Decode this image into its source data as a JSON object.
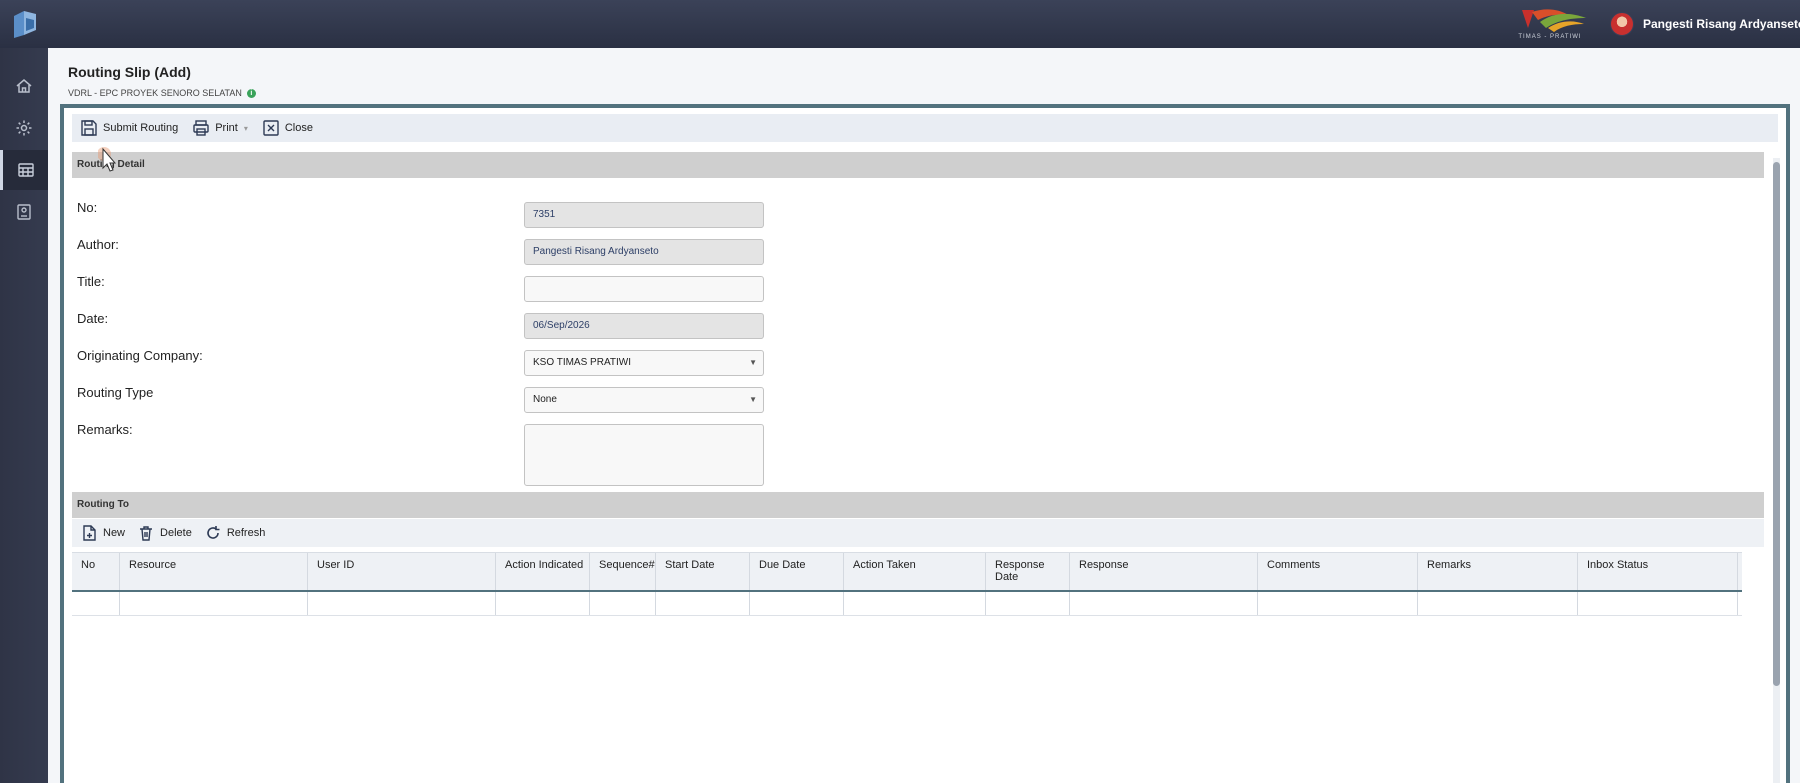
{
  "topbar": {
    "brand_logo_text": "TIMAS - PRATIWI",
    "user_name": "Pangesti Risang Ardyanseto"
  },
  "sidebar": {
    "items": [
      {
        "icon": "home-icon"
      },
      {
        "icon": "gear-icon"
      },
      {
        "icon": "dashboard-icon",
        "active": true
      },
      {
        "icon": "document-icon"
      }
    ]
  },
  "page": {
    "title": "Routing Slip (Add)",
    "subtitle": "VDRL - EPC PROYEK SENORO SELATAN"
  },
  "toolbar": {
    "submit_label": "Submit Routing",
    "print_label": "Print",
    "close_label": "Close"
  },
  "routing_detail": {
    "section_title": "Routing Detail",
    "fields": {
      "no_label": "No:",
      "no_value": "7351",
      "author_label": "Author:",
      "author_value": "Pangesti Risang Ardyanseto",
      "title_label": "Title:",
      "title_value": "",
      "date_label": "Date:",
      "date_value": "06/Sep/2026",
      "company_label": "Originating Company:",
      "company_value": "KSO TIMAS PRATIWI",
      "routing_type_label": "Routing Type",
      "routing_type_value": "None",
      "remarks_label": "Remarks:",
      "remarks_value": ""
    }
  },
  "routing_to": {
    "section_title": "Routing To",
    "new_label": "New",
    "delete_label": "Delete",
    "refresh_label": "Refresh",
    "columns": [
      "No",
      "Resource",
      "User ID",
      "Action Indicated",
      "Sequence#",
      "Start Date",
      "Due Date",
      "Action Taken",
      "Response Date",
      "Response",
      "Comments",
      "Remarks",
      "Inbox Status"
    ]
  },
  "colors": {
    "topbar": "#2f3548",
    "frame_border": "#52727e",
    "section_bar": "#cfcfcf",
    "info_dot": "#3aa35b"
  }
}
